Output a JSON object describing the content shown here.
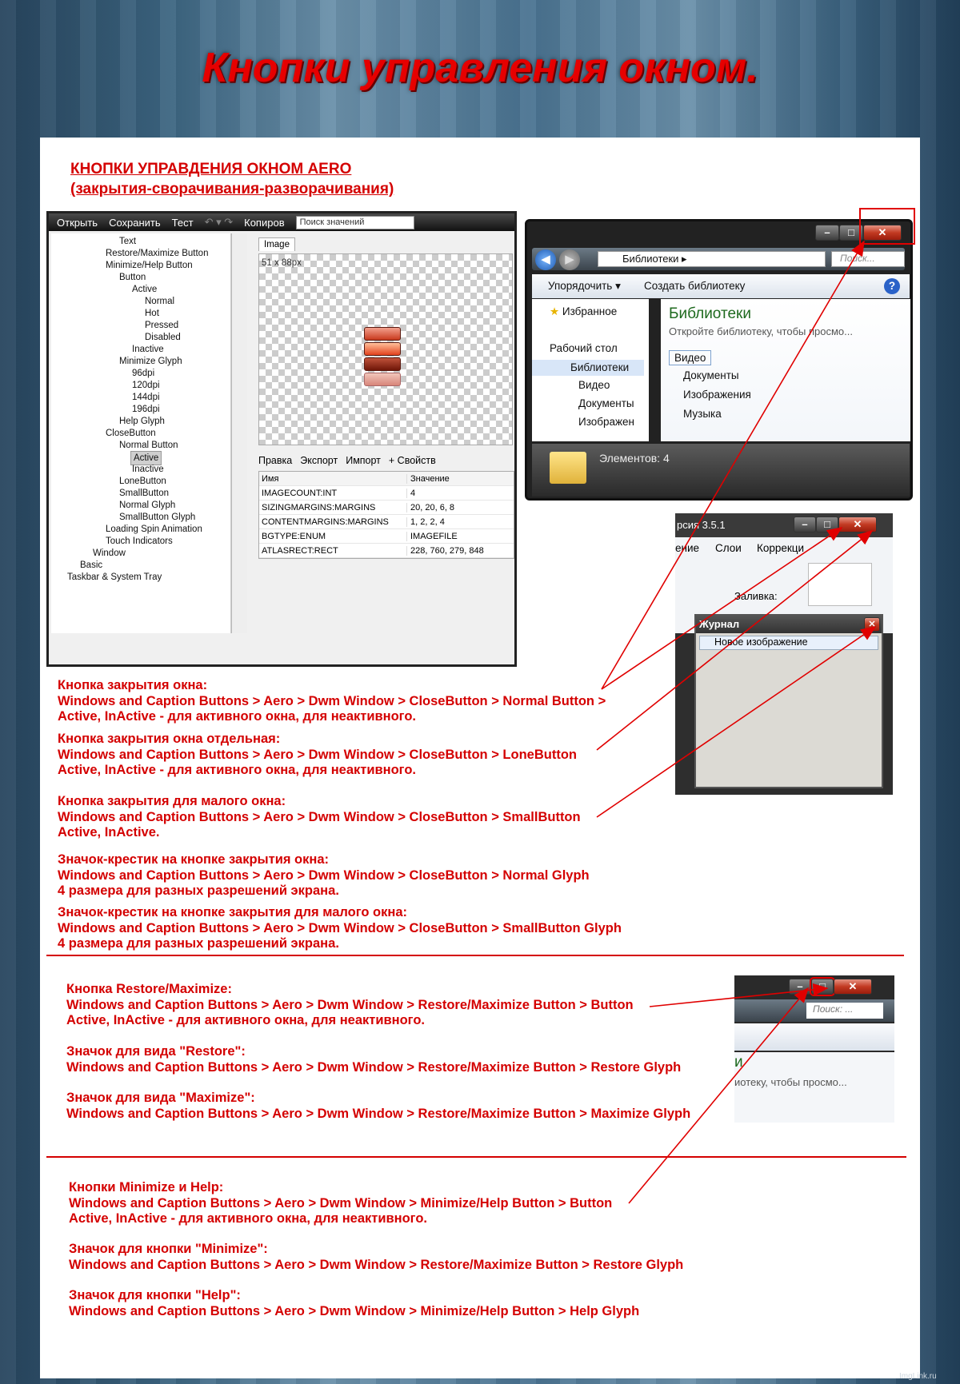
{
  "page": {
    "title": "Кнопки управления окном.",
    "header": [
      "КНОПКИ УПРАВДЕНИЯ ОКНОМ  AERO",
      "(закрытия-сворачивания-разворачивания)"
    ],
    "footer": "ImgLink.ru"
  },
  "editor": {
    "toolbar": {
      "open": "Открыть",
      "save": "Сохранить",
      "test": "Тест",
      "copy": "Копиров",
      "search_placeholder": "Поиск значений"
    },
    "tree": [
      "Text",
      "Restore/Maximize Button",
      "Minimize/Help Button",
      "Button",
      "Active",
      "Normal",
      "Hot",
      "Pressed",
      "Disabled",
      "Inactive",
      "Minimize Glyph",
      "96dpi",
      "120dpi",
      "144dpi",
      "196dpi",
      "Help Glyph",
      "CloseButton",
      "Normal Button",
      "Active",
      "Inactive",
      "LoneButton",
      "SmallButton",
      "Normal Glyph",
      "SmallButton Glyph",
      "Loading Spin Animation",
      "Touch Indicators",
      "Window",
      "Basic",
      "Taskbar & System Tray"
    ],
    "image_tab": "Image",
    "image_size": "51 x 88px",
    "props_toolbar": [
      "Правка",
      "Экспорт",
      "Импорт",
      "+ Свойств"
    ],
    "props_header": [
      "Имя",
      "Значение"
    ],
    "props": [
      [
        "IMAGECOUNT:INT",
        "4"
      ],
      [
        "SIZINGMARGINS:MARGINS",
        "20, 20, 6, 8"
      ],
      [
        "CONTENTMARGINS:MARGINS",
        "1, 2, 2, 4"
      ],
      [
        "BGTYPE:ENUM",
        "IMAGEFILE"
      ],
      [
        "ATLASRECT:RECT",
        "228, 760, 279, 848"
      ]
    ]
  },
  "explorer": {
    "address": "Библиотеки",
    "search": "Поиск...",
    "cmd": [
      "Упорядочить",
      "Создать библиотеку"
    ],
    "nav": [
      "Избранное",
      "Рабочий стол",
      "Библиотеки",
      "Видео",
      "Документы",
      "Изображен"
    ],
    "heading": "Библиотеки",
    "subheading": "Откройте библиотеку, чтобы просмо...",
    "libs": [
      "Видео",
      "Документы",
      "Изображения",
      "Музыка"
    ],
    "status": "Элементов: 4"
  },
  "small_window": {
    "title_frag": "рсия 3.5.1",
    "menu": [
      "ение",
      "Слои",
      "Коррекци"
    ],
    "fill": "Заливка:",
    "panel_title": "Журнал",
    "history_item": "Новое изображение"
  },
  "small_window2": {
    "search": "Поиск: ...",
    "heading_frag": "и",
    "sub_frag": "иотеку, чтобы просмо..."
  },
  "blocks": [
    {
      "lines": [
        "Кнопка закрытия окна:",
        "Windows and Caption Buttons > Aero > Dwm Window > CloseButton > Normal Button >",
        "Active, InActive - для активного окна, для неактивного."
      ]
    },
    {
      "lines": [
        "Кнопка закрытия окна отдельная:",
        "Windows and Caption Buttons > Aero > Dwm Window > CloseButton > LoneButton",
        "Active, InActive - для активного окна, для неактивного."
      ]
    },
    {
      "lines": [
        "Кнопка закрытия для малого окна:",
        "Windows and Caption Buttons > Aero > Dwm Window > CloseButton > SmallButton",
        "Active, InActive."
      ]
    },
    {
      "lines": [
        "Значок-крестик на кнопке закрытия окна:",
        "Windows and Caption Buttons > Aero > Dwm Window > CloseButton > Normal Glyph",
        "4 размера для разных разрешений экрана."
      ]
    },
    {
      "lines": [
        "Значок-крестик на кнопке закрытия для малого окна:",
        "Windows and Caption Buttons > Aero > Dwm Window > CloseButton > SmallButton Glyph",
        "4 размера для разных разрешений экрана."
      ]
    },
    {
      "lines": [
        "Кнопка Restore/Maximize:",
        "Windows and Caption Buttons > Aero > Dwm Window > Restore/Maximize Button > Button",
        "Active, InActive - для активного окна, для неактивного."
      ]
    },
    {
      "lines": [
        "Значок для вида \"Restore\":",
        "Windows and Caption Buttons > Aero > Dwm Window > Restore/Maximize Button > Restore Glyph"
      ]
    },
    {
      "lines": [
        "Значок для вида \"Maximize\":",
        "Windows and Caption Buttons > Aero > Dwm Window > Restore/Maximize Button > Maximize Glyph"
      ]
    },
    {
      "lines": [
        "Кнопки Minimize и Help:",
        "Windows and Caption Buttons > Aero > Dwm Window > Minimize/Help Button > Button",
        "Active, InActive - для активного окна, для неактивного."
      ]
    },
    {
      "lines": [
        "Значок для кнопки \"Minimize\":",
        "Windows and Caption Buttons > Aero > Dwm Window > Restore/Maximize Button > Restore Glyph"
      ]
    },
    {
      "lines": [
        "Значок для кнопки \"Help\":",
        "Windows and Caption Buttons > Aero > Dwm Window > Minimize/Help Button > Help Glyph"
      ]
    }
  ],
  "colors": {
    "accent": "#d40000",
    "sheet": "#ffffff"
  }
}
